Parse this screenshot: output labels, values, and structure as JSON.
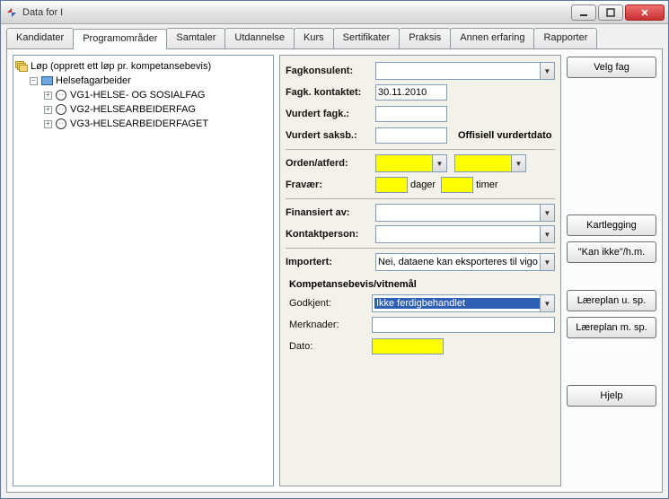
{
  "window": {
    "title": "Data for I"
  },
  "tabs": [
    {
      "label": "Kandidater"
    },
    {
      "label": "Programområder"
    },
    {
      "label": "Samtaler"
    },
    {
      "label": "Utdannelse"
    },
    {
      "label": "Kurs"
    },
    {
      "label": "Sertifikater"
    },
    {
      "label": "Praksis"
    },
    {
      "label": "Annen erfaring"
    },
    {
      "label": "Rapporter"
    }
  ],
  "tree": {
    "root_label": "Løp (opprett ett løp pr. kompetansebevis)",
    "item1": "Helsefagarbeider",
    "vg1": "VG1-HELSE- OG SOSIALFAG",
    "vg2": "VG2-HELSEARBEIDERFAG",
    "vg3": "VG3-HELSEARBEIDERFAGET"
  },
  "labels": {
    "fagkonsulent": "Fagkonsulent:",
    "fagk_kontaktet": "Fagk. kontaktet:",
    "vurdert_fagk": "Vurdert fagk.:",
    "vurdert_saksb": "Vurdert saksb.:",
    "offisiell": "Offisiell vurdertdato",
    "orden": "Orden/atferd:",
    "fravaer": "Fravær:",
    "dager": "dager",
    "timer": "timer",
    "finansiert": "Finansiert av:",
    "kontaktperson": "Kontaktperson:",
    "importert": "Importert:",
    "importert_val": "Nei, dataene kan eksporteres til vigo",
    "komp_head": "Kompetansebevis/vitnemål",
    "godkjent": "Godkjent:",
    "godkjent_val": "Ikke ferdigbehandlet",
    "merknader": "Merknader:",
    "dato": "Dato:"
  },
  "values": {
    "fagk_kontaktet": "30.11.2010"
  },
  "buttons": {
    "velg_fag": "Velg fag",
    "kartlegging": "Kartlegging",
    "kan_ikke": "\"Kan ikke\"/h.m.",
    "laereplan_u": "Læreplan u. sp.",
    "laereplan_m": "Læreplan m. sp.",
    "hjelp": "Hjelp"
  }
}
